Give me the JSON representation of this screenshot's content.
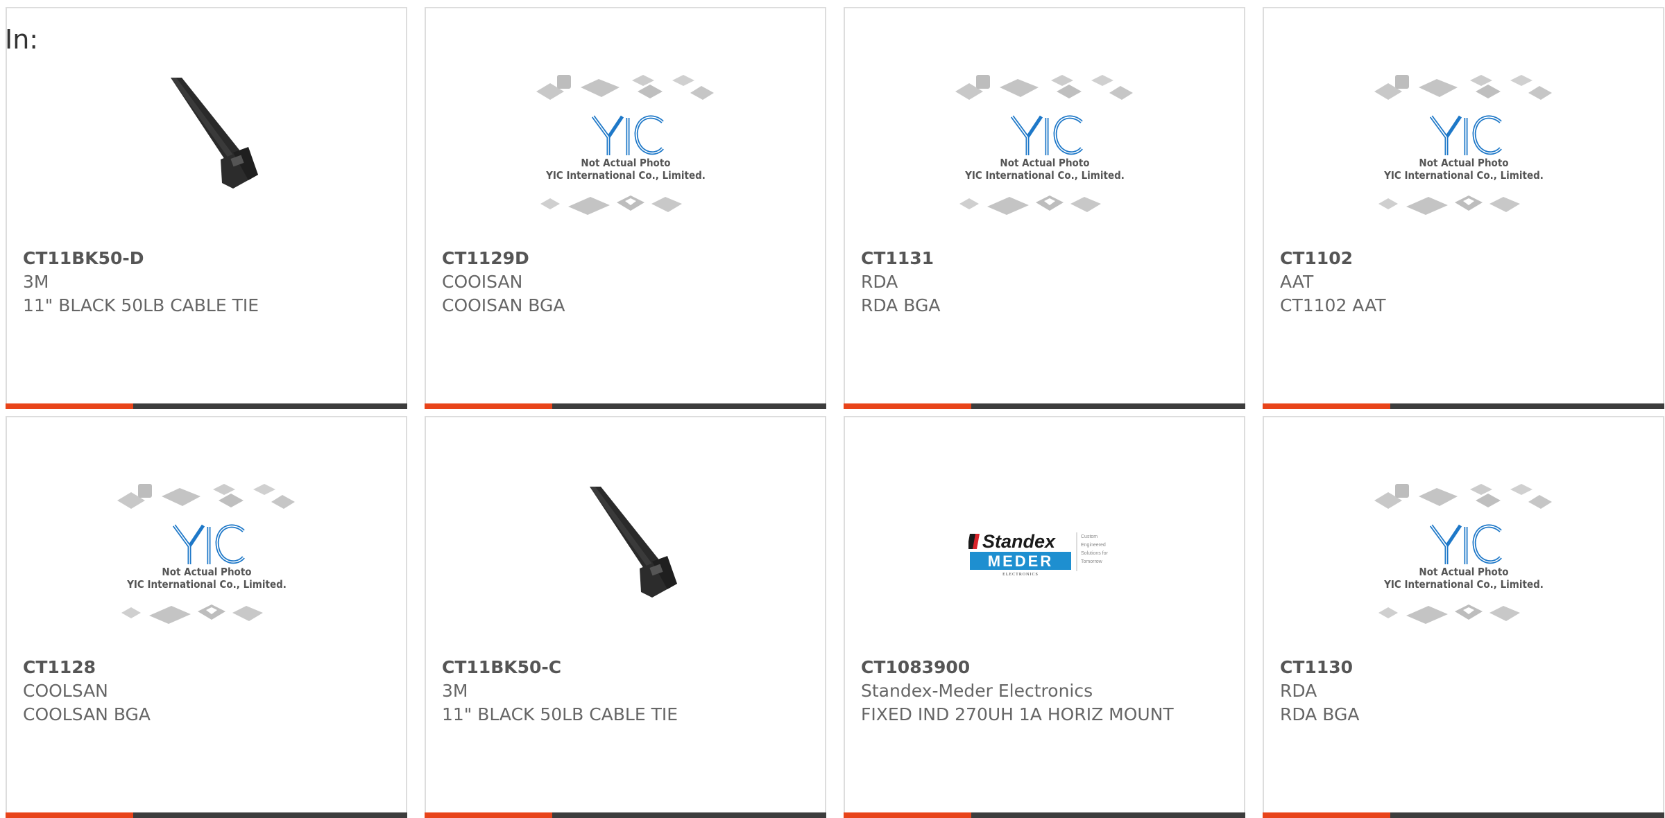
{
  "heading": "In:",
  "colors": {
    "accent": "#e8441a",
    "bar": "#3d3d3d",
    "yic_blue": "#1e78c8",
    "standex_blue": "#1e8fd0"
  },
  "placeholder": {
    "line1": "Not Actual Photo",
    "line2": "YIC International Co., Limited.",
    "logo": "YIC"
  },
  "standex_logo": {
    "top": "Standex",
    "bottom": "MEDER",
    "sub": "ELECTRONICS",
    "tagline": [
      "Custom",
      "Engineered",
      "Solutions for",
      "Tomorrow"
    ]
  },
  "products": [
    {
      "part": "CT11BK50-D",
      "manufacturer": "3M",
      "description": "11\" BLACK 50LB CABLE TIE",
      "image": "cable-tie"
    },
    {
      "part": "CT1129D",
      "manufacturer": "COOISAN",
      "description": "COOISAN BGA",
      "image": "yic-placeholder"
    },
    {
      "part": "CT1131",
      "manufacturer": "RDA",
      "description": "RDA BGA",
      "image": "yic-placeholder"
    },
    {
      "part": "CT1102",
      "manufacturer": "AAT",
      "description": "CT1102 AAT",
      "image": "yic-placeholder"
    },
    {
      "part": "CT1128",
      "manufacturer": "COOLSAN",
      "description": "COOLSAN BGA",
      "image": "yic-placeholder"
    },
    {
      "part": "CT11BK50-C",
      "manufacturer": "3M",
      "description": "11\" BLACK 50LB CABLE TIE",
      "image": "cable-tie"
    },
    {
      "part": "CT1083900",
      "manufacturer": "Standex-Meder Electronics",
      "description": "FIXED IND 270UH 1A HORIZ MOUNT",
      "image": "standex-logo"
    },
    {
      "part": "CT1130",
      "manufacturer": "RDA",
      "description": "RDA BGA",
      "image": "yic-placeholder"
    }
  ]
}
